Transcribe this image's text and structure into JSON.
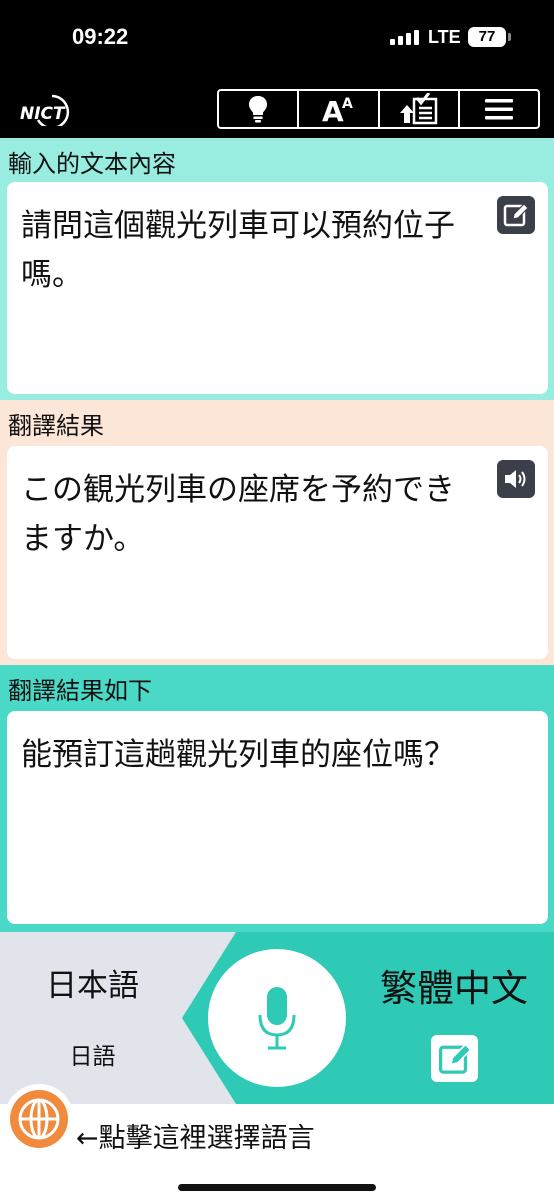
{
  "status_bar": {
    "time": "09:22",
    "network": "LTE",
    "battery": "77"
  },
  "header": {
    "logo_text": "NICT",
    "toolbar": [
      {
        "icon": "lightbulb-icon"
      },
      {
        "icon": "font-size-icon"
      },
      {
        "icon": "upload-checklist-icon"
      },
      {
        "icon": "menu-icon"
      }
    ]
  },
  "input_section": {
    "label": "輸入的文本內容",
    "text": "請問這個觀光列車可以預約位子嗎。",
    "icon": "edit-icon"
  },
  "result_section": {
    "label": "翻譯結果",
    "text": "この観光列車の座席を予約できますか。",
    "icon": "speaker-icon"
  },
  "back_translation_section": {
    "label": "翻譯結果如下",
    "text": "能預訂這趟觀光列車的座位嗎？"
  },
  "controls": {
    "source_language": "日本語",
    "source_language_sub": "日語",
    "target_language": "繁體中文",
    "mic_icon": "microphone-icon",
    "edit_icon": "edit-icon"
  },
  "footer": {
    "select_language_text": "←點擊這裡選擇語言",
    "icon": "globe-icon"
  },
  "colors": {
    "input_bg": "#98ece0",
    "result_bg": "#fce6d8",
    "back_bg": "#4ad9c6",
    "accent": "#2fcab5",
    "globe": "#f08a3c"
  }
}
